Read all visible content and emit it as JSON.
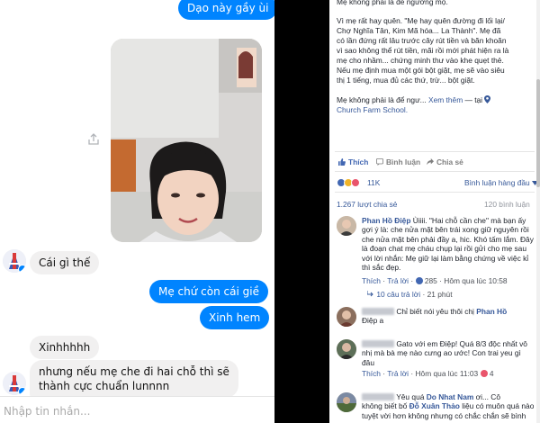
{
  "messenger": {
    "messages": [
      {
        "from": "me",
        "text": "Dạo này gầy ùi"
      },
      {
        "from": "me",
        "type": "photo"
      },
      {
        "from": "them",
        "text": "Cái gì thế"
      },
      {
        "from": "me",
        "text": "Mẹ chứ còn cái giề"
      },
      {
        "from": "me",
        "text": "Xinh hem"
      },
      {
        "from": "them",
        "text": "Xinhhhhh"
      },
      {
        "from": "them",
        "text": "nhưng nếu mẹ che đi hai chỗ thì sẽ"
      },
      {
        "from": "them",
        "text": "thành cực chuẩn lunnnn"
      }
    ],
    "composer_placeholder": "Nhập tin nhắn...",
    "icons": [
      "share-icon",
      "avatar-icon",
      "messenger-badge-icon"
    ]
  },
  "post": {
    "lines": [
      "Mẹ không phải là đế ngưỡng mộ.",
      "Vì mẹ rất hay quên. \"Mẹ hay quên đường đi lối lại/",
      "Chợ Nghĩa Tân, Kim Mã hóa... La Thành\". Mẹ đã",
      "có lần đứng rất lâu trước cây rút tiền và băn khoăn",
      "vì sao không thể rút tiền, mãi rồi mới phát hiện ra là",
      "mẹ cho nhầm... chứng minh thư vào khe quẹt thẻ.",
      "Nếu mẹ định mua một gói bột giặt, mẹ sẽ vào siêu",
      "thị 1 tiếng, mua đủ các thứ, trừ... bột giặt.",
      "Mẹ không phải là để ngư..."
    ],
    "see_more": "Xem thêm",
    "at_prefix": "— tại",
    "place": "Church Farm School.",
    "actions": {
      "like": "Thích",
      "comment": "Bình luận",
      "share": "Chia sẻ"
    },
    "reaction_count": "11K",
    "sort": "Bình luận hàng đầu",
    "shares": "1.267 lượt chia sẻ",
    "comments_count": "120 bình luận",
    "comments": [
      {
        "author": "Phan Hồ Điệp",
        "lines": [
          "Ùiiii. \"Hai chỗ cần che\" mà bạn ấy",
          "gợi ý là: che nửa mặt bên trái xong giữ nguyên rồi",
          "che nửa mặt bên phải đầy a, hic. Khó tấm lắm. Đây",
          "là đoạn chat mẹ cháu chụp lại rồi gửi cho mẹ sau",
          "với lời nhắn: Mẹ giữ lại làm bằng chứng về việc kỉ",
          "thì sắc đẹp."
        ],
        "like": "Thích",
        "reply": "Trả lời",
        "reactions": "285",
        "time": "Hôm qua lúc 10:58",
        "replies": "10 câu trả lời",
        "replies_time": "21 phút"
      },
      {
        "lines": [
          "Chỉ biết nói yêu thôi chị",
          "Điệp a"
        ],
        "mention": "Phan Hồ"
      },
      {
        "lines": [
          "Gato với em Điệp! Quá 8/3 độc nhất vô",
          "nhị mà bà mẹ nào cưng ao ước! Con trai yeu gì",
          "đâu"
        ],
        "like": "Thích",
        "reply": "Trả lời",
        "time": "Hôm qua lúc 11:03",
        "emoji_count": "4"
      },
      {
        "mention": "Do Nhat Nam",
        "lines": [
          "Yêu quá",
          "ơi... Cô",
          "không biết bố",
          "Đỗ Xuân Thảo",
          "liệu có muôn quá nào",
          "tuyệt vời hơn không nhưng có chắc chắn sẽ bình"
        ]
      }
    ]
  },
  "colors": {
    "messenger_blue": "#0084ff",
    "incoming_gray": "#f1f0f0",
    "fb_link": "#365899",
    "fb_like_blue": "#4267b2"
  }
}
